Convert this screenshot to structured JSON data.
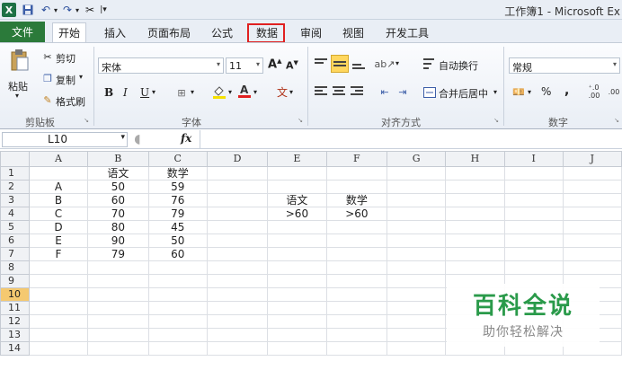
{
  "window": {
    "title": "工作簿1 - Microsoft Ex"
  },
  "tabs": [
    {
      "label": "文件"
    },
    {
      "label": "开始"
    },
    {
      "label": "插入"
    },
    {
      "label": "页面布局"
    },
    {
      "label": "公式"
    },
    {
      "label": "数据"
    },
    {
      "label": "审阅"
    },
    {
      "label": "视图"
    },
    {
      "label": "开发工具"
    }
  ],
  "ribbon": {
    "clipboard": {
      "paste": "粘贴",
      "cut": "剪切",
      "copy": "复制",
      "format_painter": "格式刷",
      "label": "剪贴板"
    },
    "font": {
      "name": "宋体",
      "size": "11",
      "label": "字体",
      "grow": "A",
      "shrink": "A"
    },
    "alignment": {
      "wrap": "自动换行",
      "merge": "合并后居中",
      "label": "对齐方式"
    },
    "number": {
      "format": "常规",
      "label": "数字",
      "percent": "%",
      "comma": ","
    }
  },
  "formula_bar": {
    "name_box": "L10",
    "fx": "fx"
  },
  "columns": [
    "A",
    "B",
    "C",
    "D",
    "E",
    "F",
    "G",
    "H",
    "I",
    "J"
  ],
  "rows": [
    {
      "n": "1",
      "cells": [
        "",
        "语文",
        "数学",
        "",
        "",
        "",
        "",
        "",
        "",
        ""
      ]
    },
    {
      "n": "2",
      "cells": [
        "A",
        "50",
        "59",
        "",
        "",
        "",
        "",
        "",
        "",
        ""
      ]
    },
    {
      "n": "3",
      "cells": [
        "B",
        "60",
        "76",
        "",
        "语文",
        "数学",
        "",
        "",
        "",
        ""
      ]
    },
    {
      "n": "4",
      "cells": [
        "C",
        "70",
        "79",
        "",
        ">60",
        ">60",
        "",
        "",
        "",
        ""
      ]
    },
    {
      "n": "5",
      "cells": [
        "D",
        "80",
        "45",
        "",
        "",
        "",
        "",
        "",
        "",
        ""
      ]
    },
    {
      "n": "6",
      "cells": [
        "E",
        "90",
        "50",
        "",
        "",
        "",
        "",
        "",
        "",
        ""
      ]
    },
    {
      "n": "7",
      "cells": [
        "F",
        "79",
        "60",
        "",
        "",
        "",
        "",
        "",
        "",
        ""
      ]
    },
    {
      "n": "8",
      "cells": [
        "",
        "",
        "",
        "",
        "",
        "",
        "",
        "",
        "",
        ""
      ]
    },
    {
      "n": "9",
      "cells": [
        "",
        "",
        "",
        "",
        "",
        "",
        "",
        "",
        "",
        ""
      ]
    },
    {
      "n": "10",
      "cells": [
        "",
        "",
        "",
        "",
        "",
        "",
        "",
        "",
        "",
        ""
      ]
    },
    {
      "n": "11",
      "cells": [
        "",
        "",
        "",
        "",
        "",
        "",
        "",
        "",
        "",
        ""
      ]
    },
    {
      "n": "12",
      "cells": [
        "",
        "",
        "",
        "",
        "",
        "",
        "",
        "",
        "",
        ""
      ]
    },
    {
      "n": "13",
      "cells": [
        "",
        "",
        "",
        "",
        "",
        "",
        "",
        "",
        "",
        ""
      ]
    },
    {
      "n": "14",
      "cells": [
        "",
        "",
        "",
        "",
        "",
        "",
        "",
        "",
        "",
        ""
      ]
    }
  ],
  "selected_row": "10",
  "watermark": {
    "title": "百科全说",
    "subtitle": "助你轻松解决"
  },
  "colors": {
    "file_tab": "#2b7a3a",
    "highlight": "#e02020",
    "selected_header": "#f5c970",
    "watermark": "#2a9a4a"
  }
}
